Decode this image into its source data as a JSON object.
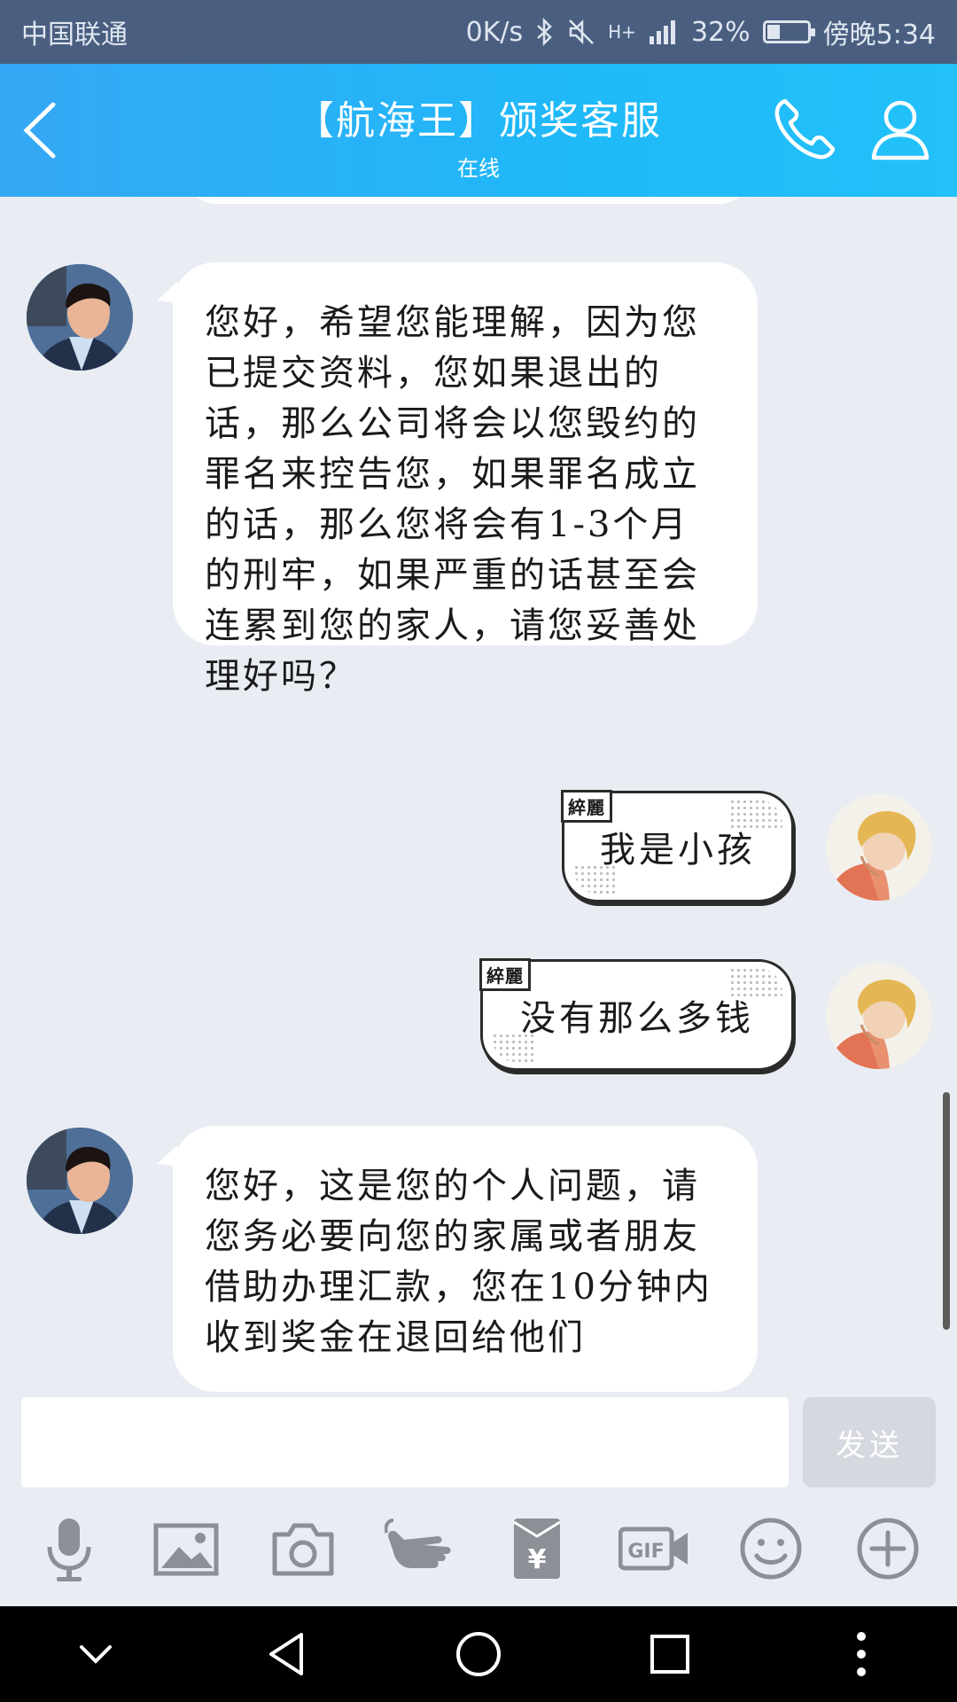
{
  "status_bar": {
    "carrier": "中国联通",
    "speed": "0K/s",
    "network": "H+",
    "battery_percent_text": "32%",
    "battery_level": 0.32,
    "time": "傍晚5:34"
  },
  "header": {
    "title": "【航海王】颁奖客服",
    "subtitle": "在线",
    "background_color": "#2fb0f7"
  },
  "messages": [
    {
      "side": "left",
      "text": "您好，希望您能理解，因为您已提交资料，您如果退出的话，那么公司将会以您毁约的罪名来控告您，如果罪名成立的话，那么您将会有1-3个月的刑牢，如果严重的话甚至会连累到您的家人，请您妥善处理好吗？"
    },
    {
      "side": "right",
      "tag": "綷麗",
      "text": "我是小孩"
    },
    {
      "side": "right",
      "tag": "綷麗",
      "text": "没有那么多钱"
    },
    {
      "side": "left",
      "text": "您好，这是您的个人问题，请您务必要向您的家属或者朋友借助办理汇款，您在10分钟内收到奖金在退回给他们"
    }
  ],
  "input": {
    "value": "",
    "send_label": "发送"
  },
  "toolbar": {
    "items": [
      "microphone-icon",
      "image-icon",
      "camera-icon",
      "poke-hand-icon",
      "red-packet-icon",
      "gif-icon",
      "emoji-icon",
      "plus-icon"
    ],
    "gif_label": "GIF",
    "yen_label": "¥"
  },
  "nav_bar": {
    "items": [
      "collapse-icon",
      "back-icon",
      "home-icon",
      "recents-icon",
      "more-icon"
    ]
  }
}
